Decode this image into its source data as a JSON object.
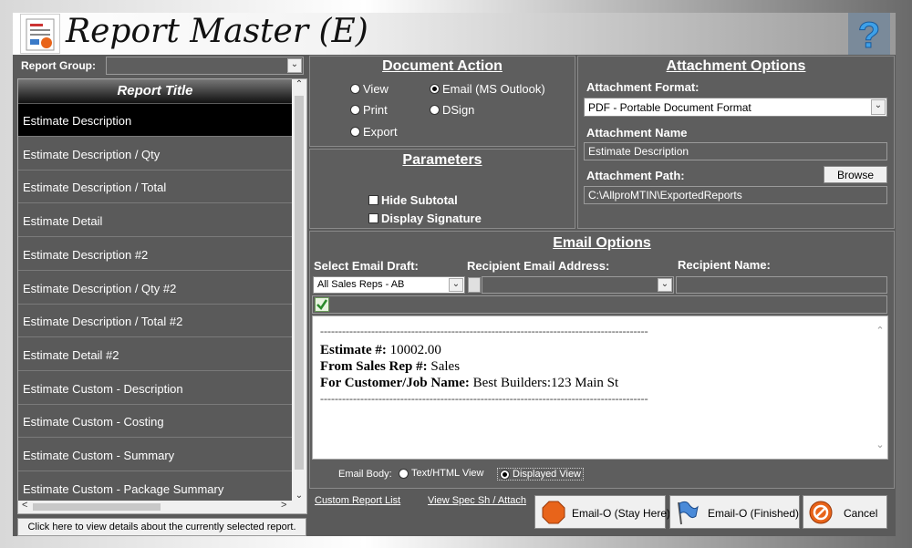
{
  "app": {
    "title": "Report Master (E)"
  },
  "report_group": {
    "label": "Report Group:",
    "value": ""
  },
  "report_list": {
    "header": "Report Title",
    "items": [
      "Estimate Description",
      "Estimate Description / Qty",
      "Estimate Description / Total",
      "Estimate Detail",
      "Estimate Description #2",
      "Estimate Description / Qty #2",
      "Estimate Description / Total #2",
      "Estimate Detail #2",
      "Estimate Custom - Description",
      "Estimate Custom - Costing",
      "Estimate Custom - Summary",
      "Estimate Custom - Package Summary"
    ],
    "selected_index": 0,
    "footer": "Click here to view details about the currently selected report."
  },
  "document_action": {
    "heading": "Document Action",
    "options": {
      "view": "View",
      "print": "Print",
      "export": "Export",
      "email": "Email (MS Outlook)",
      "dsign": "DSign"
    },
    "selected": "email"
  },
  "parameters": {
    "heading": "Parameters",
    "hide_subtotal": "Hide Subtotal",
    "display_signature": "Display Signature"
  },
  "attachment": {
    "heading": "Attachment Options",
    "format_label": "Attachment Format:",
    "format_value": "PDF - Portable Document Format",
    "name_label": "Attachment Name",
    "name_value": "Estimate Description",
    "path_label": "Attachment Path:",
    "path_value": "C:\\AllproMTIN\\ExportedReports",
    "browse_label": "Browse"
  },
  "email": {
    "heading": "Email Options",
    "draft_label": "Select Email Draft:",
    "draft_value": "All Sales Reps - AB",
    "recipient_email_label": "Recipient Email Address:",
    "recipient_email_value": "",
    "recipient_name_label": "Recipient Name:",
    "recipient_name_value": "",
    "body": {
      "rule": "------------------------------------------------------------------------------------------",
      "estimate_label": "Estimate #:",
      "estimate_value": "10002.00",
      "salesrep_label": "From Sales Rep #:",
      "salesrep_value": "Sales",
      "customer_label": "For Customer/Job Name:",
      "customer_value": "Best Builders:123 Main St"
    },
    "body_mode_label": "Email Body:",
    "body_mode_options": {
      "html": "Text/HTML View",
      "displayed": "Displayed View"
    },
    "body_mode_selected": "displayed"
  },
  "links": {
    "custom_report_list": "Custom Report List",
    "view_spec": "View Spec Sh / Attach"
  },
  "buttons": {
    "email_stay": "Email-O (Stay Here)",
    "email_finished": "Email-O (Finished)",
    "cancel": "Cancel"
  },
  "colors": {
    "panel": "#5e5e5e",
    "selected_row": "#000000",
    "stop_icon": "#e8641a"
  }
}
